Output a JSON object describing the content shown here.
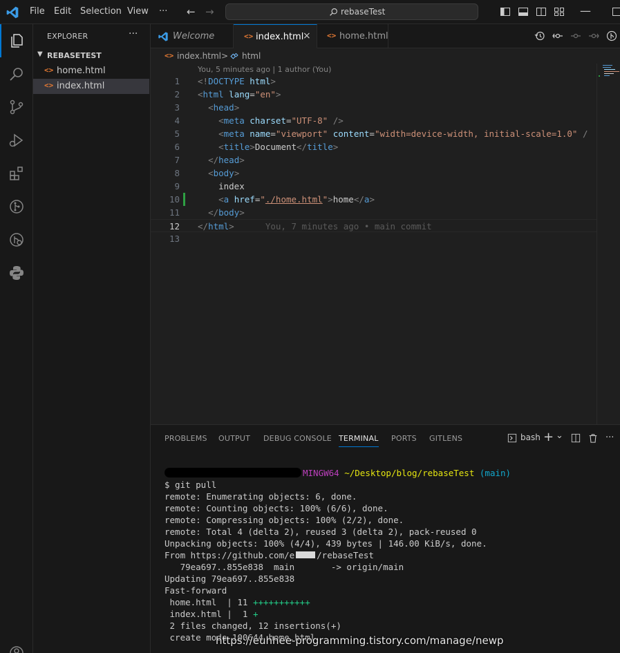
{
  "titlebar": {
    "menus": [
      "File",
      "Edit",
      "Selection",
      "View",
      "···"
    ],
    "search_text": "rebaseTest"
  },
  "activity_bar": {
    "items": [
      "explorer",
      "search",
      "source-control",
      "run-and-debug",
      "extensions",
      "gitlens",
      "remote-explorer",
      "python"
    ]
  },
  "sidebar": {
    "title": "EXPLORER",
    "more": "···",
    "folder": "REBASETEST",
    "files": [
      {
        "icon": "<>",
        "name": "home.html",
        "active": false
      },
      {
        "icon": "<>",
        "name": "index.html",
        "active": true
      }
    ]
  },
  "tabs": [
    {
      "name": "Welcome",
      "icon": "vscode",
      "active": false
    },
    {
      "name": "index.html",
      "icon": "<>",
      "active": true,
      "close": "×"
    },
    {
      "name": "home.html",
      "icon": "<>",
      "active": false
    }
  ],
  "breadcrumb": {
    "file_icon": "<>",
    "file": "index.html",
    "sep": ">",
    "symbol": "html"
  },
  "editor": {
    "blame_header": "You, 5 minutes ago | 1 author (You)",
    "current_line": 12,
    "modified_line": 10,
    "lines": [
      {
        "n": "1",
        "tokens": [
          [
            "pun",
            "<!"
          ],
          [
            "tag",
            "DOCTYPE"
          ],
          [
            "txt",
            " "
          ],
          [
            "att",
            "html"
          ],
          [
            "pun",
            ">"
          ]
        ]
      },
      {
        "n": "2",
        "tokens": [
          [
            "pun",
            "<"
          ],
          [
            "tag",
            "html"
          ],
          [
            "txt",
            " "
          ],
          [
            "att",
            "lang"
          ],
          [
            "txt",
            "="
          ],
          [
            "str",
            "\"en\""
          ],
          [
            "pun",
            ">"
          ]
        ]
      },
      {
        "n": "3",
        "tokens": [
          [
            "txt",
            "  "
          ],
          [
            "pun",
            "<"
          ],
          [
            "tag",
            "head"
          ],
          [
            "pun",
            ">"
          ]
        ]
      },
      {
        "n": "4",
        "tokens": [
          [
            "txt",
            "    "
          ],
          [
            "pun",
            "<"
          ],
          [
            "tag",
            "meta"
          ],
          [
            "txt",
            " "
          ],
          [
            "att",
            "charset"
          ],
          [
            "txt",
            "="
          ],
          [
            "str",
            "\"UTF-8\""
          ],
          [
            "txt",
            " "
          ],
          [
            "pun",
            "/>"
          ]
        ]
      },
      {
        "n": "5",
        "tokens": [
          [
            "txt",
            "    "
          ],
          [
            "pun",
            "<"
          ],
          [
            "tag",
            "meta"
          ],
          [
            "txt",
            " "
          ],
          [
            "att",
            "name"
          ],
          [
            "txt",
            "="
          ],
          [
            "str",
            "\"viewport\""
          ],
          [
            "txt",
            " "
          ],
          [
            "att",
            "content"
          ],
          [
            "txt",
            "="
          ],
          [
            "str",
            "\"width=device-width, initial-scale=1.0\""
          ],
          [
            "txt",
            " "
          ],
          [
            "pun",
            "/"
          ]
        ]
      },
      {
        "n": "6",
        "tokens": [
          [
            "txt",
            "    "
          ],
          [
            "pun",
            "<"
          ],
          [
            "tag",
            "title"
          ],
          [
            "pun",
            ">"
          ],
          [
            "txt",
            "Document"
          ],
          [
            "pun",
            "</"
          ],
          [
            "tag",
            "title"
          ],
          [
            "pun",
            ">"
          ]
        ]
      },
      {
        "n": "7",
        "tokens": [
          [
            "txt",
            "  "
          ],
          [
            "pun",
            "</"
          ],
          [
            "tag",
            "head"
          ],
          [
            "pun",
            ">"
          ]
        ]
      },
      {
        "n": "8",
        "tokens": [
          [
            "txt",
            "  "
          ],
          [
            "pun",
            "<"
          ],
          [
            "tag",
            "body"
          ],
          [
            "pun",
            ">"
          ]
        ]
      },
      {
        "n": "9",
        "tokens": [
          [
            "txt",
            "    index"
          ]
        ]
      },
      {
        "n": "10",
        "tokens": [
          [
            "txt",
            "    "
          ],
          [
            "pun",
            "<"
          ],
          [
            "tag",
            "a"
          ],
          [
            "txt",
            " "
          ],
          [
            "att",
            "href"
          ],
          [
            "txt",
            "="
          ],
          [
            "str",
            "\""
          ],
          [
            "ulink",
            "./home.html"
          ],
          [
            "str",
            "\""
          ],
          [
            "pun",
            ">"
          ],
          [
            "txt",
            "home"
          ],
          [
            "pun",
            "</"
          ],
          [
            "tag",
            "a"
          ],
          [
            "pun",
            ">"
          ]
        ]
      },
      {
        "n": "11",
        "tokens": [
          [
            "txt",
            "  "
          ],
          [
            "pun",
            "</"
          ],
          [
            "tag",
            "body"
          ],
          [
            "pun",
            ">"
          ]
        ]
      },
      {
        "n": "12",
        "tokens": [
          [
            "pun",
            "</"
          ],
          [
            "tag",
            "html"
          ],
          [
            "pun",
            ">"
          ],
          [
            "txt",
            "      "
          ],
          [
            "blame-inline",
            "You, 7 minutes ago • main commit"
          ]
        ]
      },
      {
        "n": "13",
        "tokens": []
      }
    ]
  },
  "panel": {
    "tabs": [
      "PROBLEMS",
      "OUTPUT",
      "DEBUG CONSOLE",
      "TERMINAL",
      "PORTS",
      "GITLENS"
    ],
    "active_tab": "TERMINAL",
    "shell": "bash",
    "actions": [
      "+",
      "⌄",
      "split-icon",
      "trash-icon",
      "···"
    ]
  },
  "terminal": {
    "prompt_host": "MINGW64",
    "prompt_path": "~/Desktop/blog/rebaseTest",
    "prompt_branch": "(main)",
    "command": "$ git pull",
    "output": [
      "remote: Enumerating objects: 6, done.",
      "remote: Counting objects: 100% (6/6), done.",
      "remote: Compressing objects: 100% (2/2), done.",
      "remote: Total 4 (delta 2), reused 3 (delta 2), pack-reused 0",
      "Unpacking objects: 100% (4/4), 439 bytes | 146.00 KiB/s, done."
    ],
    "from_prefix": "From https://github.com/e",
    "from_suffix": "/rebaseTest",
    "range_line": "   79ea697..855e838  main       -> origin/main",
    "updating": "Updating 79ea697..855e838",
    "fast_forward": "Fast-forward",
    "stat1_name": " home.html  | 11 ",
    "stat1_plus": "+++++++++++",
    "stat2_name": " index.html |  1 ",
    "stat2_plus": "+",
    "summary": " 2 files changed, 12 insertions(+)",
    "create_mode": " create mode 100644 home.html"
  },
  "watermark": "https://euhhee-programming.tistory.com/manage/newp",
  "colors": {
    "accent": "#0078d4",
    "editor_bg": "#1f1f1f",
    "chrome_bg": "#181818"
  }
}
